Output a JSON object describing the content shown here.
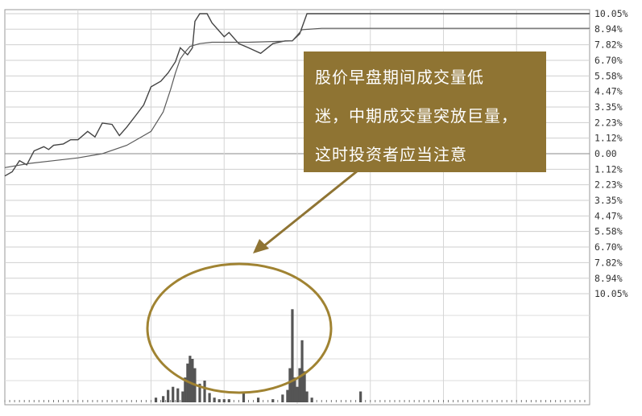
{
  "chart_data": {
    "type": "line",
    "title": "",
    "xlabel": "",
    "ylabel": "",
    "price_axis": {
      "tick_labels": [
        "10.05%",
        "8.94%",
        "7.82%",
        "6.70%",
        "5.58%",
        "4.47%",
        "3.35%",
        "2.23%",
        "1.12%",
        "0.00",
        "1.12%",
        "2.23%",
        "3.35%",
        "4.47%",
        "5.58%",
        "6.70%",
        "7.82%",
        "8.94%",
        "10.05%"
      ],
      "tick_values": [
        10.05,
        8.94,
        7.82,
        6.7,
        5.58,
        4.47,
        3.35,
        2.23,
        1.12,
        0.0,
        -1.12,
        -2.23,
        -3.35,
        -4.47,
        -5.58,
        -6.7,
        -7.82,
        -8.94,
        -10.05
      ],
      "ylim": [
        -10.05,
        10.05
      ]
    },
    "x_range": [
      0,
      240
    ],
    "grid": true,
    "series": [
      {
        "role": "price",
        "x": [
          0,
          3,
          6,
          9,
          12,
          16,
          18,
          20,
          24,
          27,
          30,
          34,
          37,
          40,
          44,
          47,
          50,
          54,
          57,
          60,
          64,
          67,
          70,
          72,
          75,
          77,
          78,
          80,
          82,
          83,
          85,
          90,
          92,
          96,
          100,
          105,
          110,
          115,
          118,
          121,
          124,
          240
        ],
        "y": [
          -1.6,
          -1.3,
          -0.5,
          -0.8,
          0.2,
          0.5,
          0.3,
          0.6,
          0.7,
          1.0,
          1.0,
          1.6,
          1.2,
          2.2,
          2.1,
          1.3,
          1.9,
          2.8,
          3.5,
          4.8,
          5.2,
          5.8,
          6.6,
          7.6,
          7.1,
          7.6,
          9.5,
          10.05,
          10.05,
          10.05,
          9.4,
          8.4,
          8.7,
          7.9,
          7.6,
          7.2,
          7.9,
          8.1,
          8.1,
          8.6,
          10.05,
          10.05
        ]
      },
      {
        "role": "average",
        "x": [
          0,
          10,
          20,
          30,
          40,
          50,
          55,
          60,
          65,
          68,
          70,
          72,
          74,
          76,
          80,
          85,
          90,
          100,
          110,
          118,
          122,
          130,
          150,
          240
        ],
        "y": [
          -1.0,
          -0.7,
          -0.5,
          -0.3,
          0.0,
          0.6,
          1.1,
          1.6,
          3.0,
          4.6,
          5.8,
          6.8,
          7.3,
          7.7,
          7.9,
          8.0,
          8.0,
          8.0,
          8.05,
          8.1,
          8.9,
          9.0,
          9.0,
          9.0
        ]
      }
    ],
    "volume": {
      "x": [
        62,
        65,
        67,
        69,
        71,
        73,
        74,
        75,
        76,
        77,
        78,
        80,
        82,
        84,
        86,
        88,
        90,
        92,
        98,
        104,
        110,
        114,
        116,
        117,
        118,
        119,
        120,
        121,
        122,
        123,
        124,
        126,
        146
      ],
      "values": [
        3,
        4,
        8,
        10,
        9,
        7,
        16,
        25,
        30,
        28,
        22,
        12,
        14,
        6,
        3,
        2,
        2,
        2,
        6,
        3,
        2,
        5,
        8,
        22,
        60,
        16,
        10,
        22,
        40,
        20,
        7,
        3,
        7
      ],
      "ylim": [
        0,
        70
      ]
    },
    "annotation": {
      "lines": [
        "股价早盘期间成交量低",
        "迷，中期成交量突放巨量，",
        "这时投资者应当注意"
      ],
      "box_color": "#8f7433",
      "arrow_color": "#8f7433",
      "ellipse_color": "#a08332"
    }
  }
}
